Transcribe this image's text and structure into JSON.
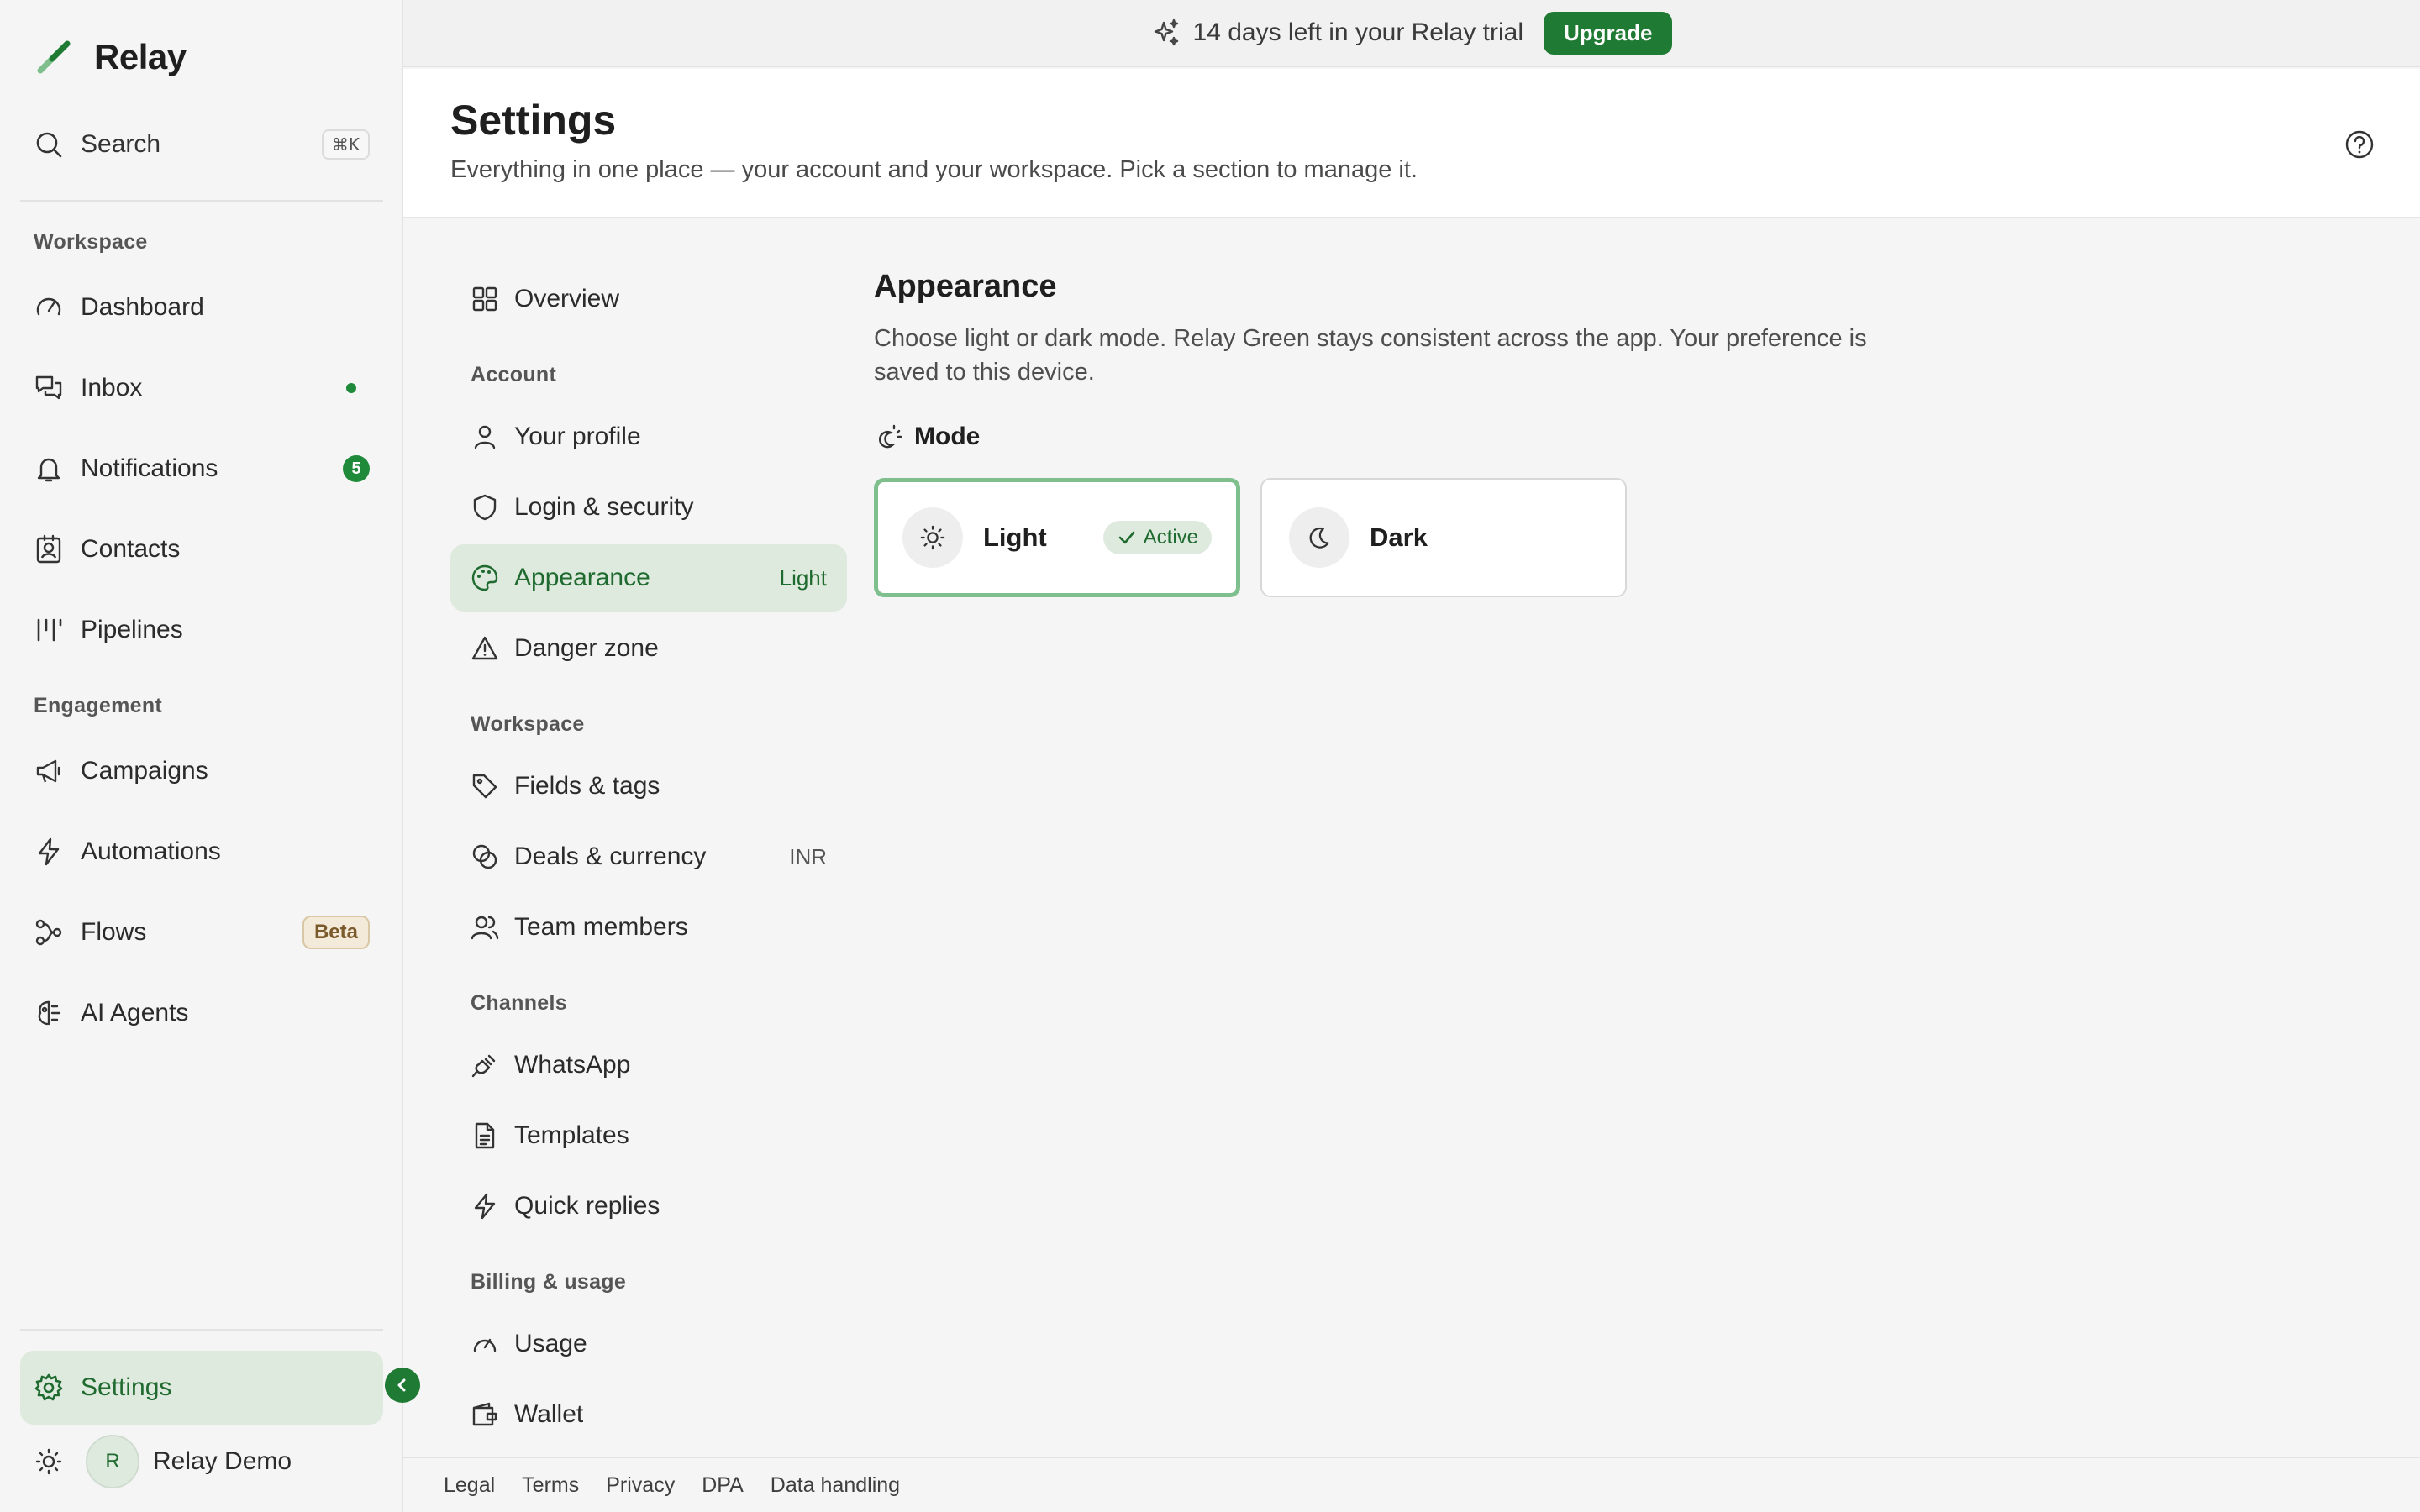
{
  "app": {
    "name": "Relay",
    "accent": "#1f7a33",
    "accent_soft": "#dfeadf"
  },
  "sidebar": {
    "search": {
      "label": "Search",
      "shortcut": "⌘K"
    },
    "sections": [
      {
        "title": "Workspace"
      },
      {
        "title": "Engagement"
      }
    ],
    "items": [
      {
        "label": "Dashboard",
        "icon": "gauge-icon"
      },
      {
        "label": "Inbox",
        "icon": "chat-bubbles-icon",
        "indicator": "dot"
      },
      {
        "label": "Notifications",
        "icon": "bell-icon",
        "count": "5"
      },
      {
        "label": "Contacts",
        "icon": "contact-card-icon"
      },
      {
        "label": "Pipelines",
        "icon": "pipeline-columns-icon"
      },
      {
        "label": "Campaigns",
        "icon": "megaphone-icon"
      },
      {
        "label": "Automations",
        "icon": "lightning-icon"
      },
      {
        "label": "Flows",
        "icon": "flow-nodes-icon",
        "badge": "Beta"
      },
      {
        "label": "AI Agents",
        "icon": "ai-brain-icon"
      }
    ],
    "settings": {
      "label": "Settings",
      "icon": "gear-icon"
    },
    "user": {
      "name": "Relay Demo",
      "initial": "R"
    }
  },
  "trial_bar": {
    "text": "14 days left in your Relay trial",
    "button": "Upgrade"
  },
  "header": {
    "title": "Settings",
    "subtitle": "Everything in one place — your account and your workspace. Pick a section to manage it."
  },
  "settings_nav": {
    "overview": "Overview",
    "sections": {
      "account": "Account",
      "workspace": "Workspace",
      "channels": "Channels",
      "billing": "Billing & usage"
    },
    "account_items": [
      {
        "label": "Your profile",
        "icon": "user-icon"
      },
      {
        "label": "Login & security",
        "icon": "shield-icon"
      },
      {
        "label": "Appearance",
        "icon": "palette-icon",
        "meta": "Light"
      },
      {
        "label": "Danger zone",
        "icon": "warning-triangle-icon"
      }
    ],
    "workspace_items": [
      {
        "label": "Fields & tags",
        "icon": "tag-icon"
      },
      {
        "label": "Deals & currency",
        "icon": "coins-icon",
        "meta": "INR"
      },
      {
        "label": "Team members",
        "icon": "users-icon"
      }
    ],
    "channels_items": [
      {
        "label": "WhatsApp",
        "icon": "plug-icon"
      },
      {
        "label": "Templates",
        "icon": "document-icon"
      },
      {
        "label": "Quick replies",
        "icon": "lightning-icon"
      }
    ],
    "billing_items": [
      {
        "label": "Usage",
        "icon": "gauge-icon"
      },
      {
        "label": "Wallet",
        "icon": "wallet-icon"
      }
    ]
  },
  "appearance": {
    "title": "Appearance",
    "description": "Choose light or dark mode. Relay Green stays consistent across the app. Your preference is saved to this device.",
    "mode_label": "Mode",
    "modes": [
      {
        "name": "Light",
        "icon": "sun-icon",
        "status": "Active"
      },
      {
        "name": "Dark",
        "icon": "moon-icon"
      }
    ]
  },
  "footer": {
    "links": [
      "Legal",
      "Terms",
      "Privacy",
      "DPA",
      "Data handling"
    ]
  }
}
